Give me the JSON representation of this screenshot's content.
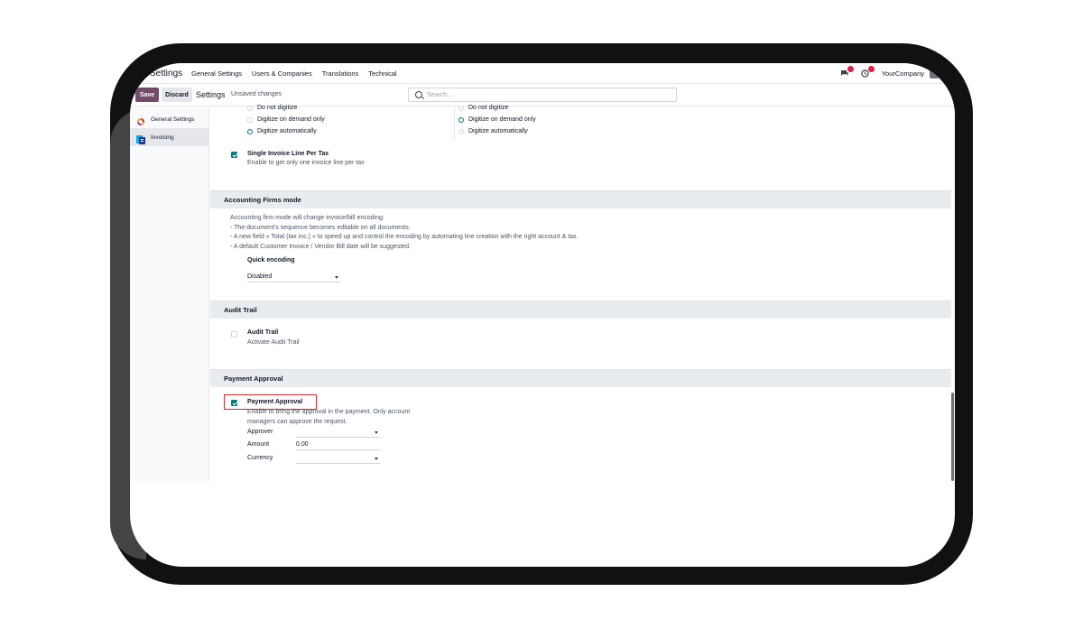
{
  "navbar": {
    "app": "Settings",
    "menu": [
      "General Settings",
      "Users & Companies",
      "Translations",
      "Technical"
    ],
    "company": "YourCompany",
    "chat_icon": "chat-icon",
    "activity_icon": "clock-icon"
  },
  "control": {
    "save": "Save",
    "discard": "Discard",
    "title": "Settings",
    "unsaved": "Unsaved changes",
    "search_placeholder": "Search..."
  },
  "sidebar": {
    "items": [
      {
        "label": "General Settings",
        "icon": "odoo-icon"
      },
      {
        "label": "Invoicing",
        "icon": "invoicing-icon"
      }
    ]
  },
  "digitize": {
    "left": {
      "options": [
        "Do not digitize",
        "Digitize on demand only",
        "Digitize automatically"
      ],
      "selected": "Digitize automatically"
    },
    "right": {
      "options": [
        "Do not digitize",
        "Digitize on demand only",
        "Digitize automatically"
      ],
      "selected": "Digitize on demand only"
    }
  },
  "single_line": {
    "title": "Single Invoice Line Per Tax",
    "desc": "Enable to get only one invoice line per tax",
    "checked": true
  },
  "firms": {
    "header": "Accounting Firms mode",
    "lines": [
      "Accounting firm mode will change invoice/bill encoding:",
      "- The document's sequence becomes editable on all documents.",
      "- A new field « Total (tax inc.) » to speed up and control the encoding by automating line creation with the right account & tax.",
      "- A default Customer Invoice / Vendor Bill date will be suggested."
    ],
    "quick_label": "Quick encoding",
    "quick_value": "Disabled"
  },
  "audit": {
    "header": "Audit Trail",
    "title": "Audit Trail",
    "desc": "Activate Audit Trail",
    "checked": false
  },
  "payment": {
    "header": "Payment Approval",
    "title": "Payment Approval",
    "desc1": "Enable to bring the approval in the payment. Only account",
    "desc2": "managers can approve the request.",
    "checked": true,
    "approver_label": "Approver",
    "approver_value": "",
    "amount_label": "Amount",
    "amount_value": "0.00",
    "currency_label": "Currency",
    "currency_value": ""
  },
  "colors": {
    "brand": "#714b67",
    "accent": "#017e84",
    "highlight": "#dc2626"
  }
}
